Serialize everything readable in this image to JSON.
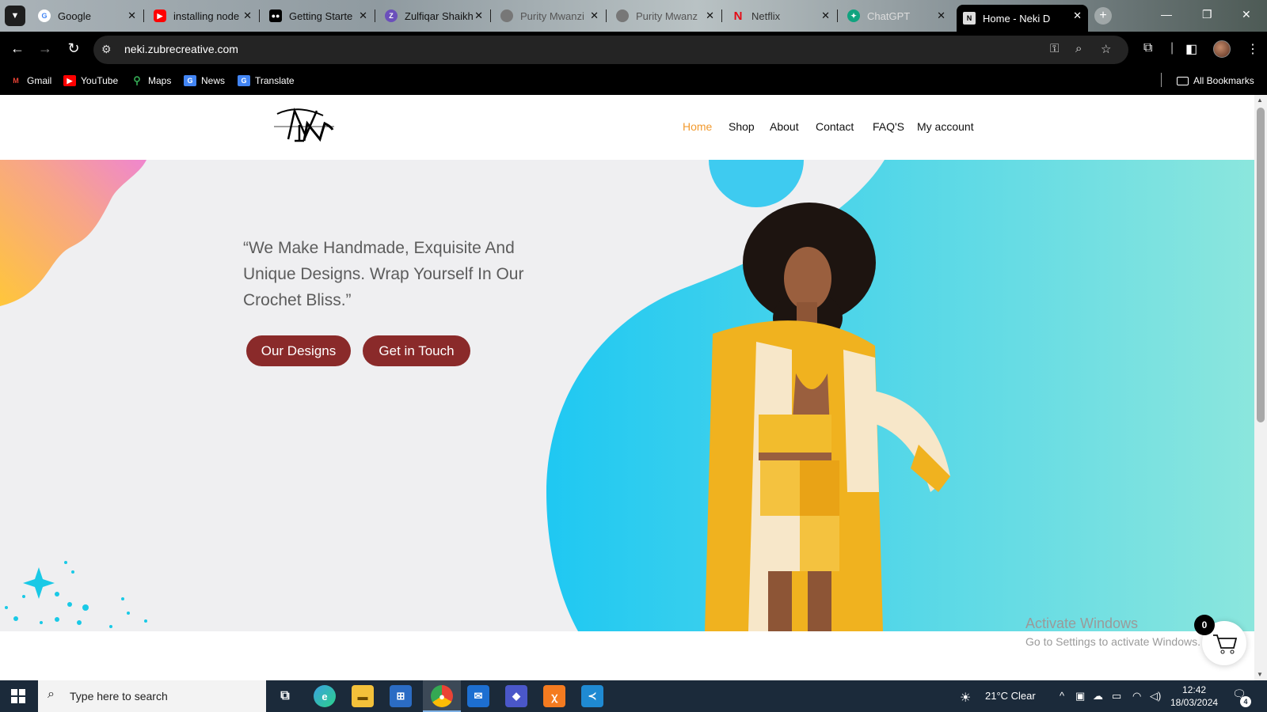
{
  "browser": {
    "tabs": [
      {
        "title": "Google",
        "favicon": "google-icon",
        "color": "#ffffff"
      },
      {
        "title": "installing node",
        "favicon": "youtube-icon",
        "color": "#ff0000"
      },
      {
        "title": "Getting Starte",
        "favicon": "medium-icon",
        "color": "#000000"
      },
      {
        "title": "Zulfiqar Shaikh",
        "favicon": "hashnode-icon",
        "color": "#6b4fbb"
      },
      {
        "title": "Purity Mwanzi",
        "favicon": "globe-icon",
        "color": "#777777"
      },
      {
        "title": "Purity Mwanz",
        "favicon": "globe-icon",
        "color": "#777777"
      },
      {
        "title": "Netflix",
        "favicon": "netflix-icon",
        "color": "#e50914"
      },
      {
        "title": "ChatGPT",
        "favicon": "chatgpt-icon",
        "color": "#10a37f"
      },
      {
        "title": "Home - Neki D",
        "favicon": "neki-icon",
        "color": "#dddddd"
      }
    ],
    "url": "neki.zubrecreative.com",
    "bookmarks": [
      {
        "label": "Gmail",
        "icon": "gmail-icon",
        "color": "#ea4335"
      },
      {
        "label": "YouTube",
        "icon": "youtube-icon",
        "color": "#ff0000"
      },
      {
        "label": "Maps",
        "icon": "maps-icon",
        "color": "#34a853"
      },
      {
        "label": "News",
        "icon": "news-icon",
        "color": "#4285f4"
      },
      {
        "label": "Translate",
        "icon": "translate-icon",
        "color": "#4285f4"
      }
    ],
    "all_bookmarks": "All Bookmarks"
  },
  "site": {
    "nav": [
      {
        "label": "Home",
        "current": true
      },
      {
        "label": "Shop",
        "current": false
      },
      {
        "label": "About",
        "current": false
      },
      {
        "label": "Contact",
        "current": false
      },
      {
        "label": "FAQ'S",
        "current": false
      },
      {
        "label": "My account",
        "current": false
      }
    ],
    "accent_color": "#f29a2e",
    "hero": {
      "quote": "“We Make Handmade, Exquisite And Unique Designs. Wrap Yourself In Our Crochet Bliss.”",
      "buttons": [
        "Our Designs",
        "Get in Touch"
      ],
      "button_color": "#8a2a2a"
    },
    "cart_count": "0"
  },
  "watermark": {
    "line1": "Activate Windows",
    "line2": "Go to Settings to activate Windows."
  },
  "taskbar": {
    "search_placeholder": "Type here to search",
    "weather": "21°C  Clear",
    "time": "12:42",
    "date": "18/03/2024",
    "notification_count": "4"
  }
}
